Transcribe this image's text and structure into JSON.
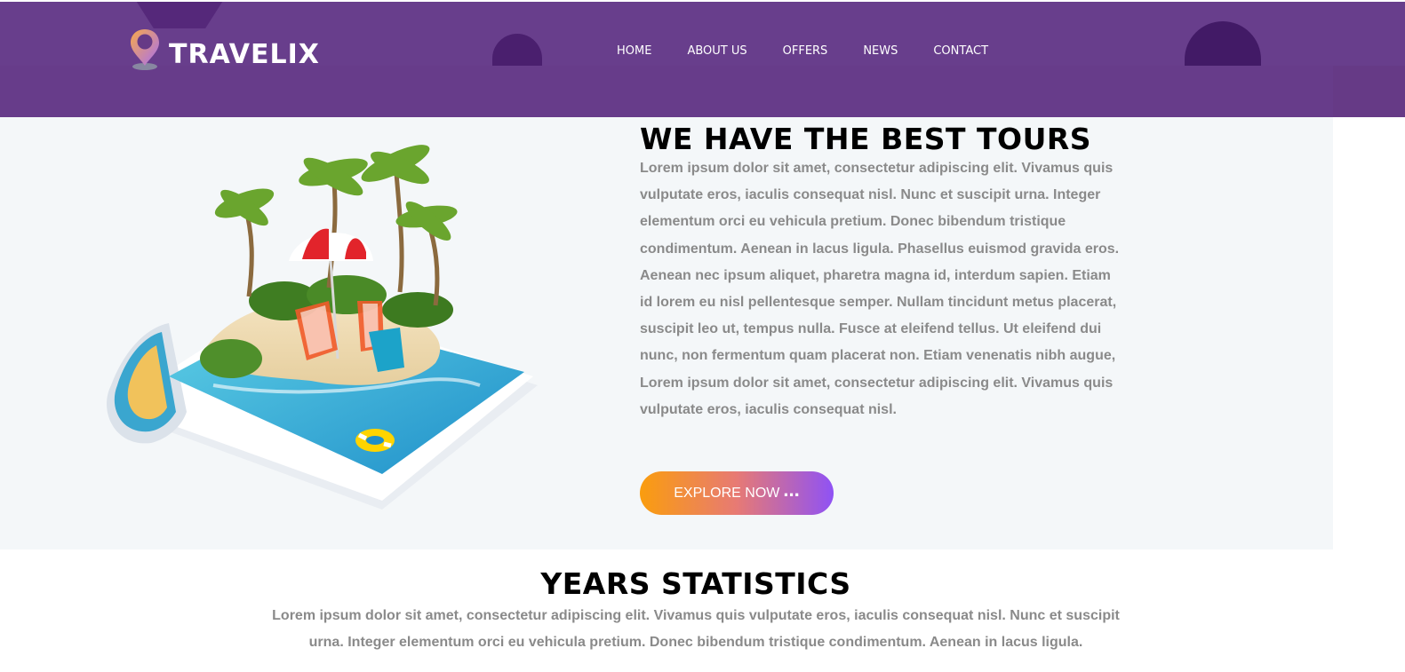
{
  "brand": {
    "name": "TRAVELIX",
    "icon": "map-pin-icon",
    "accent_colors": [
      "#fa9d0e",
      "#8f52f5"
    ],
    "header_color": "#663a86"
  },
  "nav": {
    "items": [
      "HOME",
      "ABOUT US",
      "OFFERS",
      "NEWS",
      "CONTACT"
    ]
  },
  "hero": {
    "title": "WE HAVE THE BEST TOURS",
    "text": "Lorem ipsum dolor sit amet, consectetur adipiscing elit. Vivamus quis vulputate eros, iaculis consequat nisl. Nunc et suscipit urna. Integer elementum orci eu vehicula pretium. Donec bibendum tristique condimentum. Aenean in lacus ligula. Phasellus euismod gravida eros. Aenean nec ipsum aliquet, pharetra magna id, interdum sapien. Etiam id lorem eu nisl pellentesque semper. Nullam tincidunt metus placerat, suscipit leo ut, tempus nulla. Fusce at eleifend tellus. Ut eleifend dui nunc, non fermentum quam placerat non. Etiam venenatis nibh augue, Lorem ipsum dolor sit amet, consectetur adipiscing elit. Vivamus quis vulputate eros, iaculis consequat nisl.",
    "button_label": "EXPLORE NOW",
    "button_dots": "...",
    "image": "beach-island-magazine-image"
  },
  "stats": {
    "title": "YEARS STATISTICS",
    "text": "Lorem ipsum dolor sit amet, consectetur adipiscing elit. Vivamus quis vulputate eros, iaculis consequat nisl. Nunc et suscipit urna. Integer elementum orci eu vehicula pretium. Donec bibendum tristique condimentum. Aenean in lacus ligula."
  }
}
